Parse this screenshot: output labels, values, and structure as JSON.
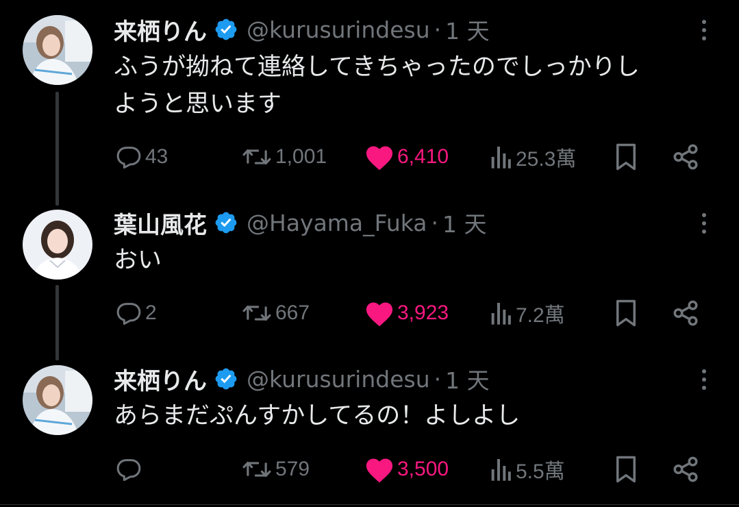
{
  "colors": {
    "background": "#000000",
    "text": "#e7e9ea",
    "muted": "#71767b",
    "like": "#f91880",
    "verified": "#1d9bf0"
  },
  "tweets": [
    {
      "display_name": "来栖りん",
      "handle": "@kurusurindesu",
      "separator": "·",
      "time": "1 天",
      "text_lines": [
        "ふうが拗ねて連絡してきちゃったのでしっかりし",
        "ようと思います"
      ],
      "replies": "43",
      "retweets": "1,001",
      "likes": "6,410",
      "views": "25.3萬",
      "liked": true
    },
    {
      "display_name": "葉山風花",
      "handle": "@Hayama_Fuka",
      "separator": "·",
      "time": "1 天",
      "text_lines": [
        "おい"
      ],
      "replies": "2",
      "retweets": "667",
      "likes": "3,923",
      "views": "7.2萬",
      "liked": true
    },
    {
      "display_name": "来栖りん",
      "handle": "@kurusurindesu",
      "separator": "·",
      "time": "1 天",
      "text_lines": [
        "あらまだぷんすかしてるの！よしよし"
      ],
      "replies": "",
      "retweets": "579",
      "likes": "3,500",
      "views": "5.5萬",
      "liked": true
    }
  ],
  "icons": {
    "verified": "verified-badge-icon",
    "more": "more-vertical-icon",
    "reply": "reply-bubble-icon",
    "retweet": "retweet-icon",
    "like": "heart-icon",
    "views": "views-bar-chart-icon",
    "bookmark": "bookmark-icon",
    "share": "share-icon"
  }
}
